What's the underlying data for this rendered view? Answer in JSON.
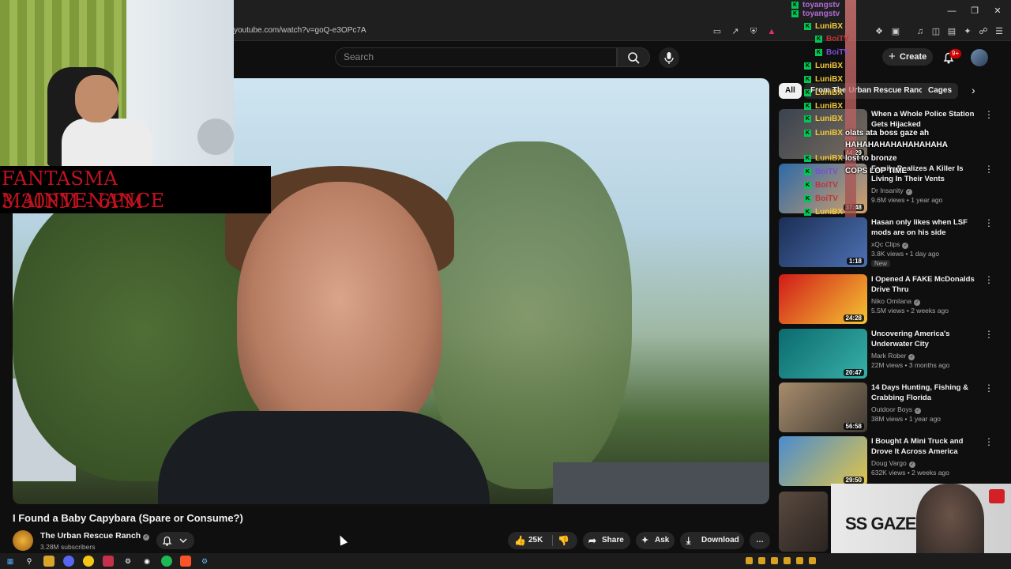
{
  "browser": {
    "url": "youtube.com/watch?v=goQ-e3OPc7A"
  },
  "header": {
    "search_placeholder": "Search",
    "create_label": "Create",
    "notif_count": "9+"
  },
  "overlay": {
    "maintenance_line1": "FANTASMA MAINTENANCE",
    "maintenance_line2": "3:30PM - 6PM",
    "chat": [
      {
        "name": "toyangstv",
        "color": "#b36bd6"
      },
      {
        "name": "toyangstv",
        "color": "#b36bd6"
      },
      {
        "name": "LuniBX",
        "color": "#f2c83a"
      },
      {
        "name": "BoiTV",
        "color": "#c23434"
      },
      {
        "name": "BoiTV",
        "color": "#7b4ed6"
      },
      {
        "name": "LuniBX",
        "color": "#f2c83a"
      },
      {
        "name": "LuniBX",
        "color": "#f2c83a"
      },
      {
        "name": "LuniBX",
        "color": "#f2c83a"
      },
      {
        "name": "LuniBX",
        "color": "#f2c83a"
      },
      {
        "name": "LuniBX",
        "color": "#f2c83a"
      },
      {
        "name": "LuniBX",
        "color": "#f2c83a"
      },
      {
        "name": "LuniBX",
        "color": "#f2c83a"
      },
      {
        "name": "BoiTV",
        "color": "#7b4ed6"
      },
      {
        "name": "BoiTV",
        "color": "#c23434"
      },
      {
        "name": "BoiTV",
        "color": "#c23434"
      },
      {
        "name": "LuniBX",
        "color": "#f2c83a"
      }
    ],
    "chat_messages": [
      "olats ata boss gaze ah",
      "HAHAHAHAHAHAHAHAHA",
      "lost to bronze",
      "COPS LOP TIME"
    ],
    "sponsor_brand": "SS GAZE"
  },
  "chips": [
    "All",
    "From The Urban Rescue Ranch",
    "Cages"
  ],
  "recommendations": [
    {
      "title": "When a Whole Police Station Gets Hijacked",
      "channel": "",
      "meta": "",
      "duration": "44:29",
      "colors": [
        "#3a4350",
        "#7a6d5d"
      ]
    },
    {
      "title": "Family Realizes A Killer Is Living In Their Vents",
      "channel": "Dr Insanity",
      "meta": "9.6M views • 1 year ago",
      "duration": "37:48",
      "colors": [
        "#2d6aa8",
        "#d4a06a"
      ]
    },
    {
      "title": "Hasan only likes when LSF mods are on his side",
      "channel": "xQc Clips",
      "meta": "3.8K views • 1 day ago",
      "duration": "1:18",
      "badge": "New",
      "colors": [
        "#1b2e55",
        "#4d71b3"
      ]
    },
    {
      "title": "I Opened A FAKE McDonalds Drive Thru",
      "channel": "Niko Omilana",
      "meta": "5.5M views • 2 weeks ago",
      "duration": "24:28",
      "colors": [
        "#d11a1a",
        "#f4c532"
      ]
    },
    {
      "title": "Uncovering America's Underwater City",
      "channel": "Mark Rober",
      "meta": "22M views • 3 months ago",
      "duration": "20:47",
      "colors": [
        "#0c6a6e",
        "#37b0a8"
      ]
    },
    {
      "title": "14 Days Hunting, Fishing & Crabbing Florida",
      "channel": "Outdoor Boys",
      "meta": "38M views • 1 year ago",
      "duration": "56:58",
      "colors": [
        "#a88c6d",
        "#3f3a32"
      ]
    },
    {
      "title": "I Bought A Mini Truck and Drove It Across America",
      "channel": "Doug Vargo",
      "meta": "632K views • 2 weeks ago",
      "duration": "29:50",
      "colors": [
        "#4a8ccf",
        "#e0c44a"
      ]
    }
  ],
  "video": {
    "title": "I Found a Baby Capybara (Spare or Consume?)",
    "channel": "The Urban Rescue Ranch",
    "subscribers": "3.28M subscribers",
    "likes": "25K",
    "share": "Share",
    "ask": "Ask",
    "download": "Download"
  },
  "colors": {
    "bg": "#0f0f0f",
    "chip": "#272727",
    "accent_red": "#cc0000"
  }
}
